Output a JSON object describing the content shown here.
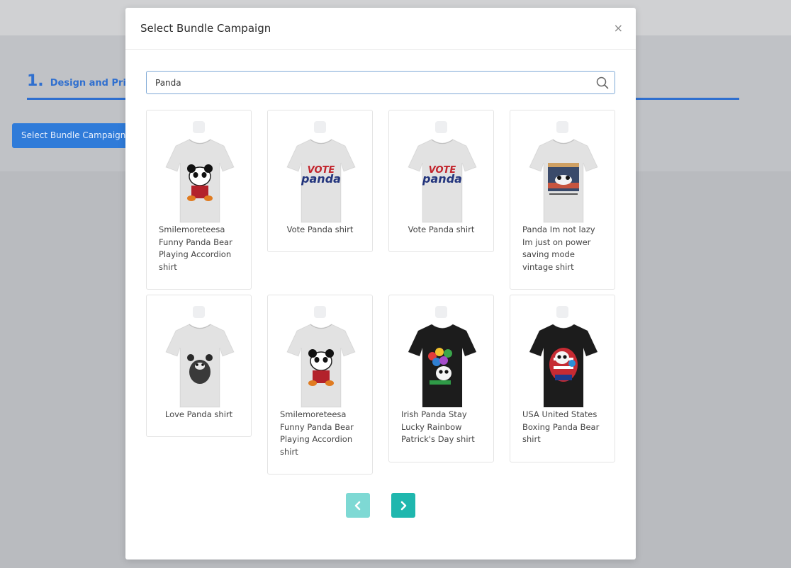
{
  "background": {
    "step_number": "1.",
    "step_label": "Design and Price",
    "select_button_label": "Select Bundle Campaign"
  },
  "modal": {
    "title": "Select Bundle Campaign",
    "close_symbol": "×",
    "search": {
      "value": "Panda",
      "icon": "search-icon"
    },
    "products": [
      {
        "title": "Smilemoreteesa Funny Panda Bear Playing Accordion shirt",
        "shirt_color": "#e2e2e2",
        "design": "panda-accordion"
      },
      {
        "title": "Vote Panda shirt",
        "shirt_color": "#e2e2e2",
        "design": "vote-panda"
      },
      {
        "title": "Vote Panda shirt",
        "shirt_color": "#e2e2e2",
        "design": "vote-panda"
      },
      {
        "title": "Panda Im not lazy Im just on power saving mode vintage shirt",
        "shirt_color": "#e2e2e2",
        "design": "panda-not-lazy"
      },
      {
        "title": "Love Panda shirt",
        "shirt_color": "#e2e2e2",
        "design": "love-panda"
      },
      {
        "title": "Smilemoreteesa Funny Panda Bear Playing Accordion shirt",
        "shirt_color": "#e2e2e2",
        "design": "panda-accordion"
      },
      {
        "title": "Irish Panda Stay Lucky Rainbow Patrick's Day shirt",
        "shirt_color": "#1c1c1c",
        "design": "irish-panda"
      },
      {
        "title": "USA United States Boxing Panda Bear shirt",
        "shirt_color": "#1c1c1c",
        "design": "usa-panda"
      }
    ],
    "pagination": {
      "prev_icon": "chevron-left-icon",
      "next_icon": "chevron-right-icon"
    }
  },
  "colors": {
    "accent": "#2f6fcf",
    "pager_active": "#1fb7ae",
    "pager_disabled": "#7ed9d4"
  }
}
